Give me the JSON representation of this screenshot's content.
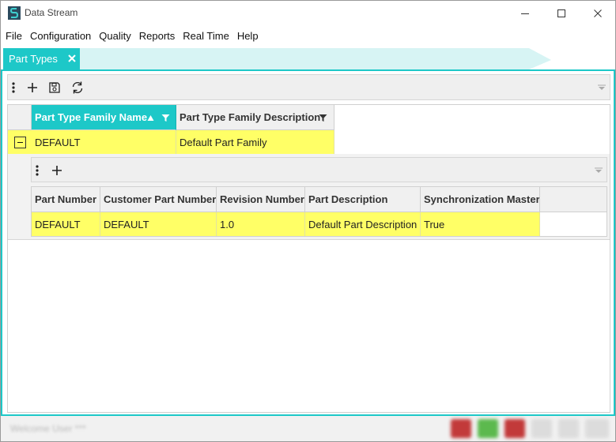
{
  "window": {
    "title": "Data Stream"
  },
  "menu": {
    "items": [
      "File",
      "Configuration",
      "Quality",
      "Reports",
      "Real Time",
      "Help"
    ]
  },
  "tab": {
    "label": "Part Types"
  },
  "main_grid": {
    "columns": [
      "Part Type Family Name",
      "Part Type Family Description"
    ],
    "rows": [
      [
        "DEFAULT",
        "Default Part Family"
      ]
    ]
  },
  "detail_grid": {
    "columns": [
      "Part Number",
      "Customer Part Number",
      "Revision Number",
      "Part Description",
      "Synchronization Master"
    ],
    "rows": [
      [
        "DEFAULT",
        "DEFAULT",
        "1.0",
        "Default Part Description",
        "True"
      ]
    ]
  },
  "status": {
    "text": "Welcome User  ***"
  },
  "colors": {
    "accent": "#1dc8c8",
    "selected_row": "#ffff66"
  },
  "icons": [
    "app-logo",
    "minimize-icon",
    "maximize-icon",
    "close-icon",
    "tab-close-icon",
    "more-vertical-icon",
    "add-icon",
    "save-icon",
    "refresh-icon",
    "sort-ascending-icon",
    "filter-icon",
    "dropdown-arrow-icon",
    "collapse-icon"
  ]
}
